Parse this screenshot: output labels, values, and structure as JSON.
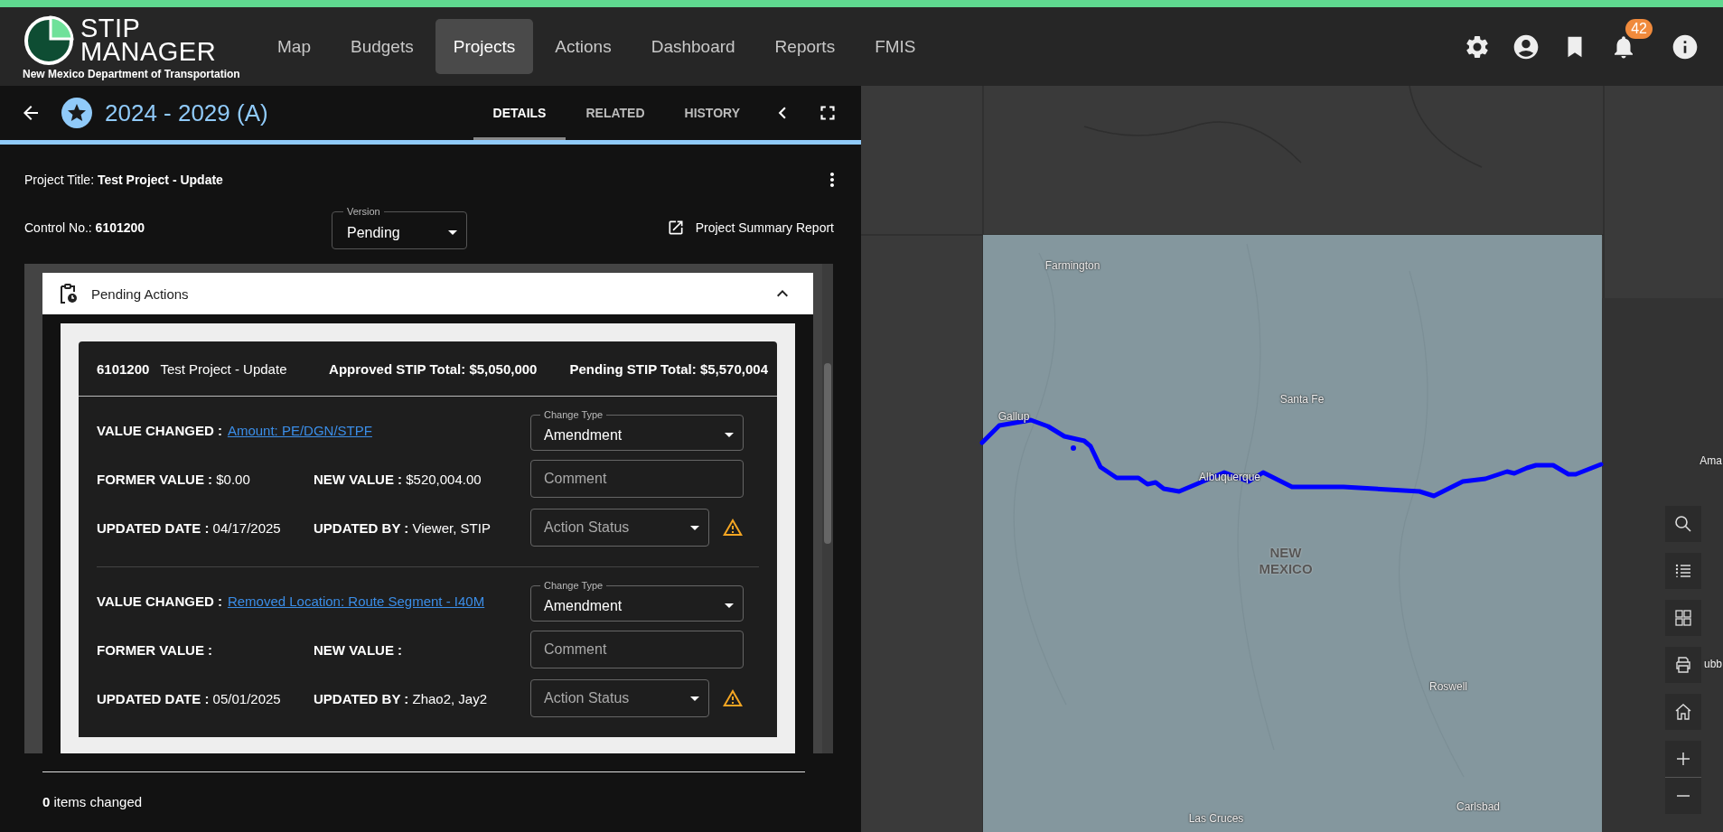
{
  "app": {
    "logo_lines": [
      "STIP",
      "MANAGER"
    ],
    "subtitle": "New Mexico Department of Transportation"
  },
  "nav": [
    {
      "label": "Map",
      "selected": false
    },
    {
      "label": "Budgets",
      "selected": false
    },
    {
      "label": "Projects",
      "selected": true
    },
    {
      "label": "Actions",
      "selected": false
    },
    {
      "label": "Dashboard",
      "selected": false
    },
    {
      "label": "Reports",
      "selected": false
    },
    {
      "label": "FMIS",
      "selected": false
    }
  ],
  "notifications": {
    "count": "42"
  },
  "project_header": {
    "title": "2024 - 2029 (A)",
    "tabs": [
      {
        "label": "DETAILS",
        "selected": true
      },
      {
        "label": "RELATED",
        "selected": false
      },
      {
        "label": "HISTORY",
        "selected": false
      }
    ]
  },
  "details": {
    "title_label": "Project Title:",
    "title_value": "Test Project - Update",
    "control_label": "Control No.:",
    "control_value": "6101200",
    "version": {
      "label": "Version",
      "value": "Pending"
    },
    "report_link": "Project Summary Report"
  },
  "pending": {
    "heading": "Pending Actions",
    "expanded": true,
    "summary": {
      "control": "6101200",
      "title": "Test Project - Update",
      "approved": "Approved STIP Total: $5,050,000",
      "pending": "Pending STIP Total: $5,570,004"
    },
    "actions": [
      {
        "value_changed_label": "VALUE CHANGED :",
        "value_changed": "Amount: PE/DGN/STPF",
        "former_label": "FORMER VALUE :",
        "former": "$0.00",
        "new_label": "NEW VALUE :",
        "new": "$520,004.00",
        "date_label": "UPDATED DATE :",
        "date": "04/17/2025",
        "by_label": "UPDATED BY :",
        "by": "Viewer, STIP",
        "change_type": {
          "label": "Change Type",
          "value": "Amendment"
        },
        "comment_placeholder": "Comment",
        "status_placeholder": "Action Status",
        "warning": true
      },
      {
        "value_changed_label": "VALUE CHANGED :",
        "value_changed": "Removed Location: Route Segment - I40M",
        "former_label": "FORMER VALUE :",
        "new_label": "NEW VALUE :",
        "date_label": "UPDATED DATE :",
        "date": "05/01/2025",
        "by_label": "UPDATED BY :",
        "by": "Zhao2, Jay2",
        "change_type": {
          "label": "Change Type",
          "value": "Amendment"
        },
        "comment_placeholder": "Comment",
        "status_placeholder": "Action Status",
        "warning": true
      }
    ]
  },
  "footer": {
    "summary": "**0** items changed"
  },
  "map": {
    "region_label": "NEW MEXICO",
    "places": [
      "Farmington",
      "Santa Fe",
      "Gallup",
      "Albuquerque",
      "Roswell",
      "Carlsbad",
      "Las Cruces",
      "Ama",
      "ubb"
    ]
  }
}
